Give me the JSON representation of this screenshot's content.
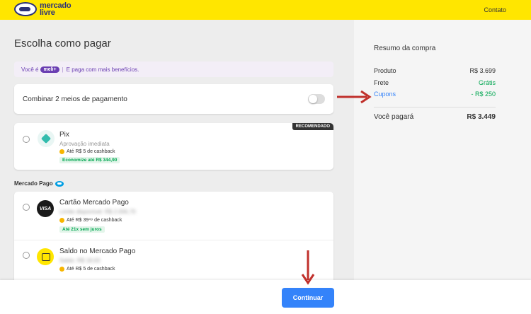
{
  "header": {
    "logo_line1": "mercado",
    "logo_line2": "livre",
    "contact_link": "Contato"
  },
  "main": {
    "title": "Escolha como pagar",
    "promo": {
      "prefix": "Você é",
      "badge": "meli+",
      "separator": "|",
      "text": "E paga com mais benefícios."
    },
    "combine": {
      "label": "Combinar 2 meios de pagamento",
      "enabled": false
    },
    "pix": {
      "name": "Pix",
      "subtitle": "Aprovação imediata",
      "cashback": "Até R$ 5 de cashback",
      "savings_badge": "Economize até R$ 344,90",
      "recommended_badge": "RECOMENDADO",
      "icon": "pix-icon"
    },
    "section_label": "Mercado Pago",
    "mp_options": [
      {
        "name": "Cartão Mercado Pago",
        "subtitle": "Limite disponível: R$ 2.056,70",
        "cashback": "Até R$ 39⁴⁹ de cashback",
        "badge": "Até 21x sem juros",
        "icon": "visa-card-icon",
        "icon_text": "VISA"
      },
      {
        "name": "Saldo no Mercado Pago",
        "subtitle": "Saldo: R$ 18,63",
        "cashback": "Até R$ 5 de cashback",
        "icon": "wallet-icon"
      }
    ]
  },
  "summary": {
    "title": "Resumo da compra",
    "rows": [
      {
        "label": "Produto",
        "value": "R$ 3.699"
      },
      {
        "label": "Frete",
        "value": "Grátis"
      },
      {
        "label": "Cupons",
        "value": "- R$ 250"
      }
    ],
    "total_label": "Você pagará",
    "total_value": "R$ 3.449"
  },
  "footer": {
    "continue_label": "Continuar"
  },
  "colors": {
    "header_yellow": "#ffe600",
    "primary_blue": "#3483fa",
    "success_green": "#00a650",
    "meli_purple": "#6a3db2",
    "annotation_red": "#c0302b"
  }
}
